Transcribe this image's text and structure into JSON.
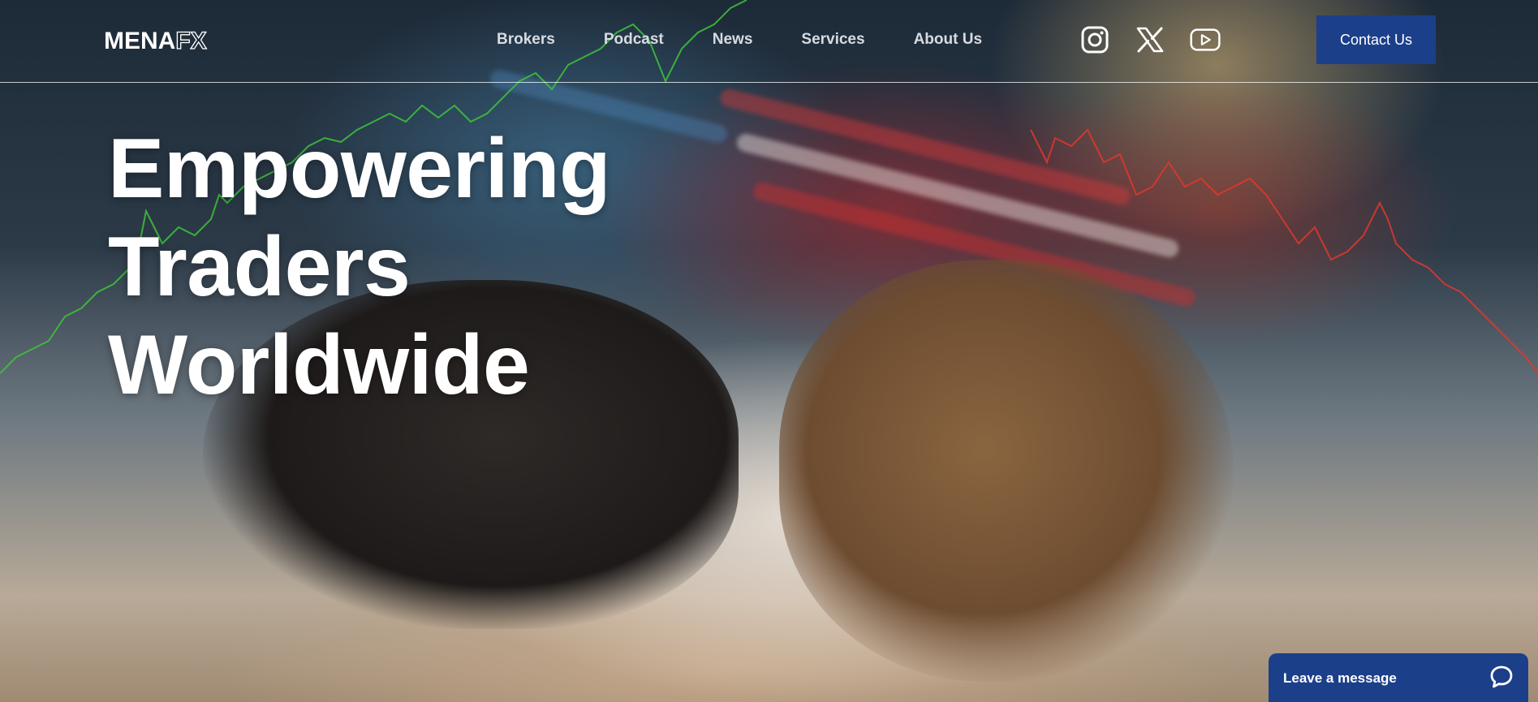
{
  "brand": {
    "logo_main": "MENA",
    "logo_accent": "FX"
  },
  "nav": {
    "items": [
      {
        "label": "Brokers"
      },
      {
        "label": "Podcast"
      },
      {
        "label": "News"
      },
      {
        "label": "Services"
      },
      {
        "label": "About Us"
      }
    ]
  },
  "social": {
    "icons": [
      "instagram-icon",
      "x-icon",
      "youtube-icon"
    ]
  },
  "header": {
    "contact_label": "Contact Us"
  },
  "hero": {
    "headline_line1": "Empowering Traders",
    "headline_line2": "Worldwide",
    "image_subject": "bull-vs-bear-icon"
  },
  "chat": {
    "label": "Leave a message",
    "icon": "chat-bubble-icon"
  },
  "colors": {
    "accent": "#1c3f8a",
    "text": "#ffffff",
    "nav_text": "#d7dbe0",
    "chart_up": "#3ec43a",
    "chart_down": "#e2372c"
  }
}
